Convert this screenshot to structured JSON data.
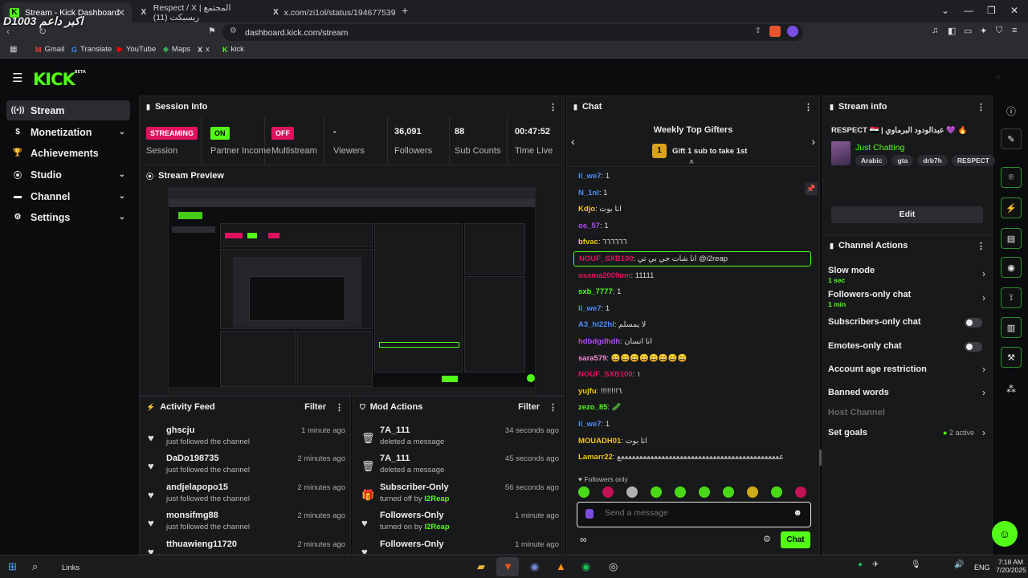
{
  "browser": {
    "tabs": [
      {
        "label": "Stream - Kick Dashboard",
        "icon": "kick-icon",
        "active": true
      },
      {
        "label": "Respect / X | المجتمع ريسبكت (11)",
        "icon": "x-icon",
        "active": false
      },
      {
        "label": "x.com/zi1ol/status/19467753936018",
        "icon": "x-icon",
        "active": false
      }
    ],
    "new_tab": "+",
    "url": "dashboard.kick.com/stream",
    "watermark": "D1003 اكبر داعم",
    "bookmarks": [
      {
        "label": "Gmail",
        "icon": "M"
      },
      {
        "label": "Translate",
        "icon": "G"
      },
      {
        "label": "YouTube",
        "icon": "▶"
      },
      {
        "label": "Maps",
        "icon": "◆"
      },
      {
        "label": "x",
        "icon": "X"
      },
      {
        "label": "kick",
        "icon": "K"
      }
    ]
  },
  "app": {
    "logo": "KICK",
    "logo_badge": "BETA",
    "nav": [
      {
        "label": "Stream",
        "icon": "stream-icon",
        "glyph": "((•))",
        "active": true,
        "chevron": false
      },
      {
        "label": "Monetization",
        "icon": "dollar-icon",
        "glyph": "$",
        "active": false,
        "chevron": true
      },
      {
        "label": "Achievements",
        "icon": "trophy-icon",
        "glyph": "🏆",
        "active": false,
        "chevron": false
      },
      {
        "label": "Studio",
        "icon": "studio-icon",
        "glyph": "⦿",
        "active": false,
        "chevron": true
      },
      {
        "label": "Channel",
        "icon": "channel-icon",
        "glyph": "▬",
        "active": false,
        "chevron": true
      },
      {
        "label": "Settings",
        "icon": "gear-icon",
        "glyph": "⚙",
        "active": false,
        "chevron": true
      }
    ]
  },
  "session": {
    "title": "Session Info",
    "stats": [
      {
        "value": "STREAMING",
        "label": "Session",
        "pill": true,
        "color": "#e0135c"
      },
      {
        "value": "ON",
        "label": "Partner Income",
        "pill": true,
        "color": "#53fc18"
      },
      {
        "value": "OFF",
        "label": "Multistream",
        "pill": true,
        "color": "#e0135c"
      },
      {
        "value": "-",
        "label": "Viewers",
        "pill": false
      },
      {
        "value": "36,091",
        "label": "Followers",
        "pill": false
      },
      {
        "value": "88",
        "label": "Sub Counts",
        "pill": false
      },
      {
        "value": "00:47:52",
        "label": "Time Live",
        "pill": false
      }
    ]
  },
  "preview": {
    "title": "Stream Preview"
  },
  "activity": {
    "title": "Activity Feed",
    "filter": "Filter",
    "items": [
      {
        "name": "ghscju",
        "sub": "just followed the channel",
        "time": "1 minute ago"
      },
      {
        "name": "DaDo198735",
        "sub": "just followed the channel",
        "time": "2 minutes ago"
      },
      {
        "name": "andjelapopo15",
        "sub": "just followed the channel",
        "time": "2 minutes ago"
      },
      {
        "name": "monsifmg88",
        "sub": "just followed the channel",
        "time": "2 minutes ago"
      },
      {
        "name": "tthuawieng11720",
        "sub": "",
        "time": "2 minutes ago"
      }
    ]
  },
  "mod": {
    "title": "Mod Actions",
    "filter": "Filter",
    "items": [
      {
        "name": "7A_111",
        "sub": "deleted a message",
        "by": "",
        "time": "34 seconds ago",
        "icon": "trash-icon",
        "glyph": "🗑"
      },
      {
        "name": "7A_111",
        "sub": "deleted a message",
        "by": "",
        "time": "45 seconds ago",
        "icon": "trash-icon",
        "glyph": "🗑"
      },
      {
        "name": "Subscriber-Only",
        "sub": "turned off by ",
        "by": "I2Reap",
        "time": "56 seconds ago",
        "icon": "gift-icon",
        "glyph": "🎁"
      },
      {
        "name": "Followers-Only",
        "sub": "turned on by ",
        "by": "I2Reap",
        "time": "1 minute ago",
        "icon": "heart-icon",
        "glyph": "♥"
      },
      {
        "name": "Followers-Only",
        "sub": "",
        "by": "",
        "time": "1 minute ago",
        "icon": "heart-icon",
        "glyph": "♥"
      }
    ]
  },
  "chat": {
    "title": "Chat",
    "gifters_title": "Weekly Top Gifters",
    "gifter_rank": "1",
    "gifter_text": "Gift 1 sub to take 1st",
    "messages": [
      {
        "user": "il_we7",
        "color": "#4f8ff7",
        "text": "1"
      },
      {
        "user": "N_1nI",
        "color": "#4f8ff7",
        "text": "1"
      },
      {
        "user": "Kdjo",
        "color": "#f0c419",
        "text": "انا بوت"
      },
      {
        "user": "os_57",
        "color": "#b14cf5",
        "text": "1"
      },
      {
        "user": "bfvac",
        "color": "#f0c419",
        "text": "٦٦٦٦٦٦"
      },
      {
        "user": "NOUF_SXB100",
        "color": "#e0135c",
        "text": "انا شات جي بي تي @i2reap",
        "highlight": true
      },
      {
        "user": "osama2009om",
        "color": "#e0135c",
        "text": "11111"
      },
      {
        "user": "sxb_7777",
        "color": "#53fc18",
        "text": "1"
      },
      {
        "user": "il_we7",
        "color": "#4f8ff7",
        "text": "1"
      },
      {
        "user": "A3_hl22hl",
        "color": "#4f8ff7",
        "text": "لا يمسلم"
      },
      {
        "user": "hdbdgdhdh",
        "color": "#b14cf5",
        "text": "انا انسان"
      },
      {
        "user": "sara579",
        "color": "#f08ad6",
        "text": "😄😄😄😄😄😄😄😄"
      },
      {
        "user": "NOUF_SXB100",
        "color": "#e0135c",
        "text": "١"
      },
      {
        "user": "yujfu",
        "color": "#f0c419",
        "text": "!!!!!!!!٦"
      },
      {
        "user": "zezo_85",
        "color": "#53fc18",
        "text": "🥒"
      },
      {
        "user": "il_we7",
        "color": "#4f8ff7",
        "text": "1"
      },
      {
        "user": "MOUADH01",
        "color": "#f0c419",
        "text": "انا بوت"
      },
      {
        "user": "Lamarr22",
        "color": "#f0c419",
        "text": "ععععععععععععععععععععععععععععععععععععععععععععع"
      }
    ],
    "followers_only": "Followers only",
    "input_placeholder": "Send a message",
    "send_label": "Chat"
  },
  "stream_info": {
    "title": "Stream info",
    "stream_title": "RESPECT 🇮🇶 | عبدالودود البرماوي 💜 🔥",
    "category": "Just Chatting",
    "tags": [
      "Arabic",
      "gta",
      "drb7h",
      "RESPECT"
    ],
    "edit_label": "Edit"
  },
  "channel_actions": {
    "title": "Channel Actions",
    "items": [
      {
        "label": "Slow mode",
        "sub": "1 sec",
        "control": "chevron"
      },
      {
        "label": "Followers-only chat",
        "sub": "1 min",
        "control": "chevron"
      },
      {
        "label": "Subscribers-only chat",
        "sub": "",
        "control": "toggle"
      },
      {
        "label": "Emotes-only chat",
        "sub": "",
        "control": "toggle"
      },
      {
        "label": "Account age restriction",
        "sub": "",
        "control": "chevron"
      },
      {
        "label": "Banned words",
        "sub": "",
        "control": "chevron"
      },
      {
        "label": "Host Channel",
        "sub": "",
        "control": "none",
        "disabled": true
      },
      {
        "label": "Set goals",
        "sub": "",
        "control": "chevron",
        "extra": "2 active"
      }
    ]
  },
  "taskbar": {
    "search_label": "Links",
    "lang": "ENG",
    "time": "7:18 AM",
    "date": "7/20/2025"
  },
  "colors": {
    "accent": "#53fc18",
    "live": "#e0135c",
    "panel": "#18191b"
  }
}
